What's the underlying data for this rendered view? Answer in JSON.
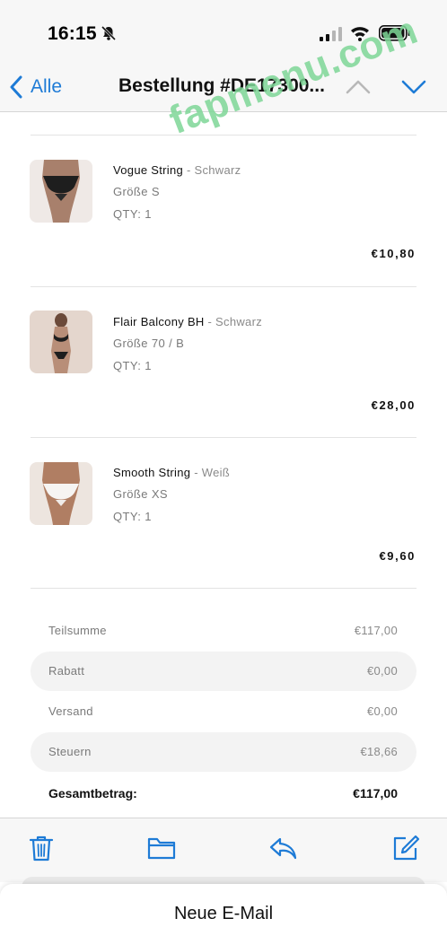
{
  "status_bar": {
    "time": "16:15",
    "icons": [
      "bell-slash-icon",
      "signal-icon",
      "wifi-icon",
      "battery-icon"
    ]
  },
  "nav": {
    "back_label": "Alle",
    "title": "Bestellung #DE17300...",
    "icons": [
      "chevron-left-icon",
      "chevron-up-icon",
      "chevron-down-icon"
    ]
  },
  "items": [
    {
      "name": "Vogue String",
      "variant": " - Schwarz",
      "size": "Größe S",
      "qty": "QTY: 1",
      "price": "€10,80",
      "thumb_color": "#c8a89a"
    },
    {
      "name": "Flair Balcony BH",
      "variant": " - Schwarz",
      "size": "Größe 70 / B",
      "qty": "QTY: 1",
      "price": "€28,00",
      "thumb_color": "#d9c7bd"
    },
    {
      "name": "Smooth String",
      "variant": " - Weiß",
      "size": "Größe XS",
      "qty": "QTY: 1",
      "price": "€9,60",
      "thumb_color": "#d8b8a4"
    }
  ],
  "summary": {
    "rows": [
      {
        "label": "Teilsumme",
        "value": "€117,00"
      },
      {
        "label": "Rabatt",
        "value": "€0,00"
      },
      {
        "label": "Versand",
        "value": "€0,00"
      },
      {
        "label": "Steuern",
        "value": "€18,66"
      }
    ],
    "total_label": "Gesamtbetrag:",
    "total_value": "€117,00"
  },
  "toolbar": {
    "icons": [
      "trash-icon",
      "folder-icon",
      "reply-icon",
      "compose-icon"
    ]
  },
  "draft": {
    "title": "Neue E-Mail"
  },
  "watermark": "fapmenu.com",
  "colors": {
    "accent": "#1e7bd6",
    "watermark": "#7ed696"
  }
}
